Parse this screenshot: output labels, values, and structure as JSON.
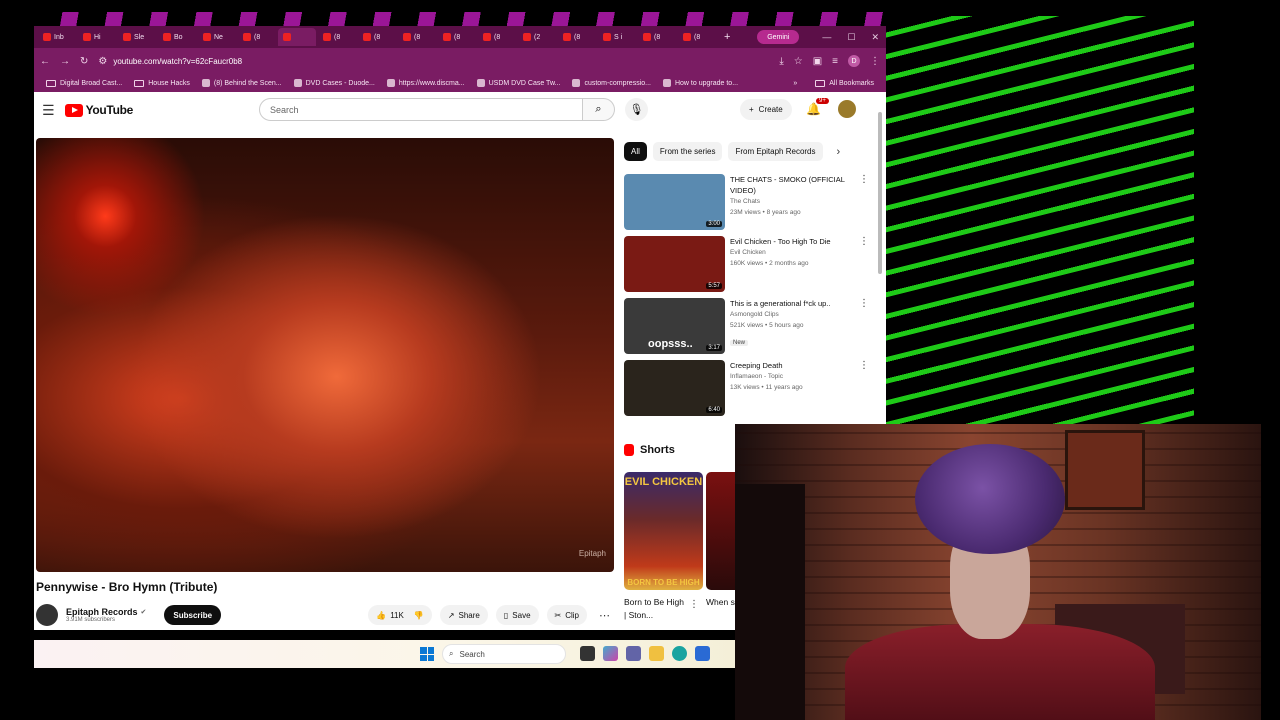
{
  "browser": {
    "tabs": [
      {
        "label": "Inb",
        "icon": "gmail-icon"
      },
      {
        "label": "Hi",
        "icon": "app-icon"
      },
      {
        "label": "Sle",
        "icon": "play-icon"
      },
      {
        "label": "Bo",
        "icon": "star-icon"
      },
      {
        "label": "Ne",
        "icon": "chrome-icon"
      },
      {
        "label": "(8",
        "icon": "youtube-icon"
      },
      {
        "label": "",
        "icon": "youtube-icon"
      },
      {
        "label": "(8",
        "icon": "youtube-icon"
      },
      {
        "label": "(8",
        "icon": "youtube-icon"
      },
      {
        "label": "(8",
        "icon": "youtube-icon"
      },
      {
        "label": "(8",
        "icon": "youtube-icon"
      },
      {
        "label": "(8",
        "icon": "youtube-icon"
      },
      {
        "label": "(2",
        "icon": "x-icon"
      },
      {
        "label": "(8",
        "icon": "youtube-icon"
      },
      {
        "label": "S i",
        "icon": "app-icon"
      },
      {
        "label": "(8",
        "icon": "youtube-icon"
      },
      {
        "label": "(8",
        "icon": "youtube-icon"
      }
    ],
    "new_tab": "+",
    "gemini_label": "Gemini",
    "url": "youtube.com/watch?v=62cFaucr0b8",
    "profile_initial": "D",
    "bookmarks": [
      {
        "label": "Digital Broad Cast...",
        "type": "folder"
      },
      {
        "label": "House Hacks",
        "type": "folder"
      },
      {
        "label": "(8) Behind the Scen...",
        "type": "link"
      },
      {
        "label": "DVD Cases - Duode...",
        "type": "link"
      },
      {
        "label": "https://www.discma...",
        "type": "link"
      },
      {
        "label": "USDM DVD Case Tw...",
        "type": "link"
      },
      {
        "label": "custom-compressio...",
        "type": "link"
      },
      {
        "label": "How to upgrade to...",
        "type": "link"
      }
    ],
    "more_bookmarks": "»",
    "all_bookmarks": "All Bookmarks"
  },
  "youtube": {
    "logo": "YouTube",
    "search_placeholder": "Search",
    "create_label": "Create",
    "notif_count": "9+",
    "video": {
      "title": "Pennywise - Bro Hymn (Tribute)",
      "channel": "Epitaph Records",
      "subscribers": "3.91M subscribers",
      "subscribe_label": "Subscribe",
      "watermark": "Epitaph",
      "likes": "11K",
      "share_label": "Share",
      "save_label": "Save",
      "clip_label": "Clip"
    },
    "chips": [
      "All",
      "From the series",
      "From Epitaph Records"
    ],
    "recommendations": [
      {
        "title": "THE CHATS - SMOKO (OFFICIAL VIDEO)",
        "channel": "The Chats",
        "meta": "23M views • 8 years ago",
        "duration": "3:00",
        "badge": "",
        "thumb_color": "#5a8ab0"
      },
      {
        "title": "Evil Chicken - Too High To Die",
        "channel": "Evil Chicken",
        "meta": "160K views • 2 months ago",
        "duration": "5:57",
        "badge": "",
        "thumb_color": "#7a1a14"
      },
      {
        "title": "This is a generational f*ck up..",
        "channel": "Asmongold Clips",
        "meta": "521K views • 5 hours ago",
        "duration": "3:17",
        "badge": "New",
        "thumb_color": "#3a3a3a",
        "thumb_text": "oopsss.."
      },
      {
        "title": "Creeping Death",
        "channel": "Inflamaeon - Topic",
        "meta": "13K views • 11 years ago",
        "duration": "6:40",
        "badge": "",
        "thumb_color": "#2a241c"
      }
    ],
    "shorts": {
      "heading": "Shorts",
      "items": [
        {
          "caption": "Born to Be High | Ston...",
          "thumb_top": "EVIL CHICKEN",
          "thumb_bottom": "BORN TO BE HIGH"
        },
        {
          "caption": "When securi..."
        }
      ]
    }
  },
  "taskbar": {
    "search_label": "Search"
  }
}
